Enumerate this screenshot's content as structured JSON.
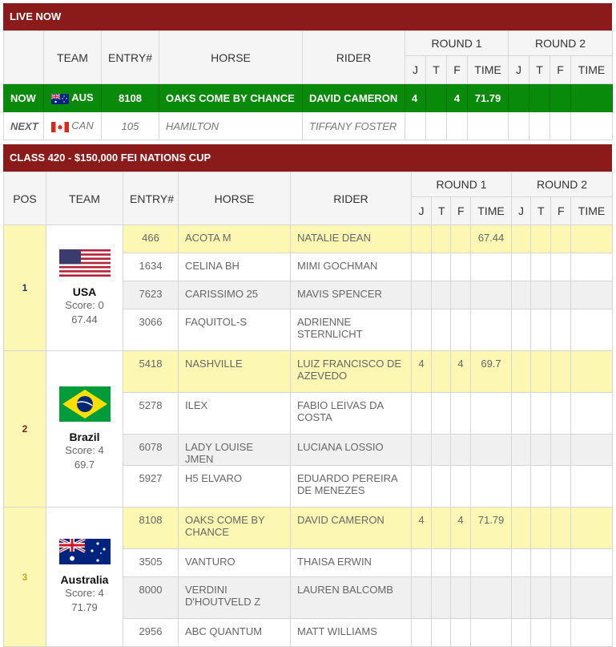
{
  "live": {
    "title": "LIVE NOW",
    "headers": {
      "team": "TEAM",
      "entry": "ENTRY#",
      "horse": "HORSE",
      "rider": "RIDER",
      "round1": "ROUND 1",
      "round2": "ROUND 2",
      "j": "J",
      "t": "T",
      "f": "F",
      "time": "TIME"
    },
    "now": {
      "label": "NOW",
      "team": "AUS",
      "entry": "8108",
      "horse": "OAKS COME BY CHANCE",
      "rider": "DAVID CAMERON",
      "r1_j": "4",
      "r1_t": "",
      "r1_f": "4",
      "r1_time": "71.79"
    },
    "next": {
      "label": "NEXT",
      "team": "CAN",
      "entry": "105",
      "horse": "HAMILTON",
      "rider": "TIFFANY FOSTER"
    }
  },
  "class": {
    "title": "CLASS 420 - $150,000 FEI NATIONS CUP",
    "headers": {
      "pos": "POS",
      "team": "TEAM",
      "entry": "ENTRY#",
      "horse": "HORSE",
      "rider": "RIDER",
      "round1": "ROUND 1",
      "round2": "ROUND 2",
      "j": "J",
      "t": "T",
      "f": "F",
      "time": "TIME"
    },
    "teams": [
      {
        "pos": "1",
        "name": "USA",
        "score": "Score: 0",
        "total": "67.44",
        "flag": "usa-flag-icon",
        "entries": [
          {
            "entry": "466",
            "horse": "ACOTA M",
            "rider": "NATALIE DEAN",
            "j": "",
            "t": "",
            "f": "",
            "time": "67.44"
          },
          {
            "entry": "1634",
            "horse": "CELINA BH",
            "rider": "MIMI GOCHMAN",
            "j": "",
            "t": "",
            "f": "",
            "time": ""
          },
          {
            "entry": "7623",
            "horse": "CARISSIMO 25",
            "rider": "MAVIS SPENCER",
            "j": "",
            "t": "",
            "f": "",
            "time": ""
          },
          {
            "entry": "3066",
            "horse": "FAQUITOL-S",
            "rider": "ADRIENNE STERNLICHT",
            "j": "",
            "t": "",
            "f": "",
            "time": ""
          }
        ]
      },
      {
        "pos": "2",
        "name": "Brazil",
        "score": "Score: 4",
        "total": "69.7",
        "flag": "brazil-flag-icon",
        "entries": [
          {
            "entry": "5418",
            "horse": "NASHVILLE",
            "rider": "LUIZ FRANCISCO DE AZEVEDO",
            "j": "4",
            "t": "",
            "f": "4",
            "time": "69.7"
          },
          {
            "entry": "5278",
            "horse": "ILEX",
            "rider": "FABIO LEIVAS DA COSTA",
            "j": "",
            "t": "",
            "f": "",
            "time": ""
          },
          {
            "entry": "6078",
            "horse": "LADY LOUISE JMEN",
            "rider": "LUCIANA LOSSIO",
            "j": "",
            "t": "",
            "f": "",
            "time": ""
          },
          {
            "entry": "5927",
            "horse": "H5 ELVARO",
            "rider": "EDUARDO PEREIRA DE MENEZES",
            "j": "",
            "t": "",
            "f": "",
            "time": ""
          }
        ]
      },
      {
        "pos": "3",
        "name": "Australia",
        "score": "Score: 4",
        "total": "71.79",
        "flag": "australia-flag-icon",
        "entries": [
          {
            "entry": "8108",
            "horse": "OAKS COME BY CHANCE",
            "rider": "DAVID CAMERON",
            "j": "4",
            "t": "",
            "f": "4",
            "time": "71.79"
          },
          {
            "entry": "3505",
            "horse": "VANTURO",
            "rider": "THAISA ERWIN",
            "j": "",
            "t": "",
            "f": "",
            "time": ""
          },
          {
            "entry": "8000",
            "horse": "VERDINI D'HOUTVELD Z",
            "rider": "LAUREN BALCOMB",
            "j": "",
            "t": "",
            "f": "",
            "time": ""
          },
          {
            "entry": "2956",
            "horse": "ABC QUANTUM",
            "rider": "MATT WILLIAMS",
            "j": "",
            "t": "",
            "f": "",
            "time": ""
          }
        ]
      }
    ]
  },
  "colors": {
    "header_bar": "#8b1a1a",
    "now_row": "#0a8a0a",
    "highlight": "#fcf7b3"
  }
}
